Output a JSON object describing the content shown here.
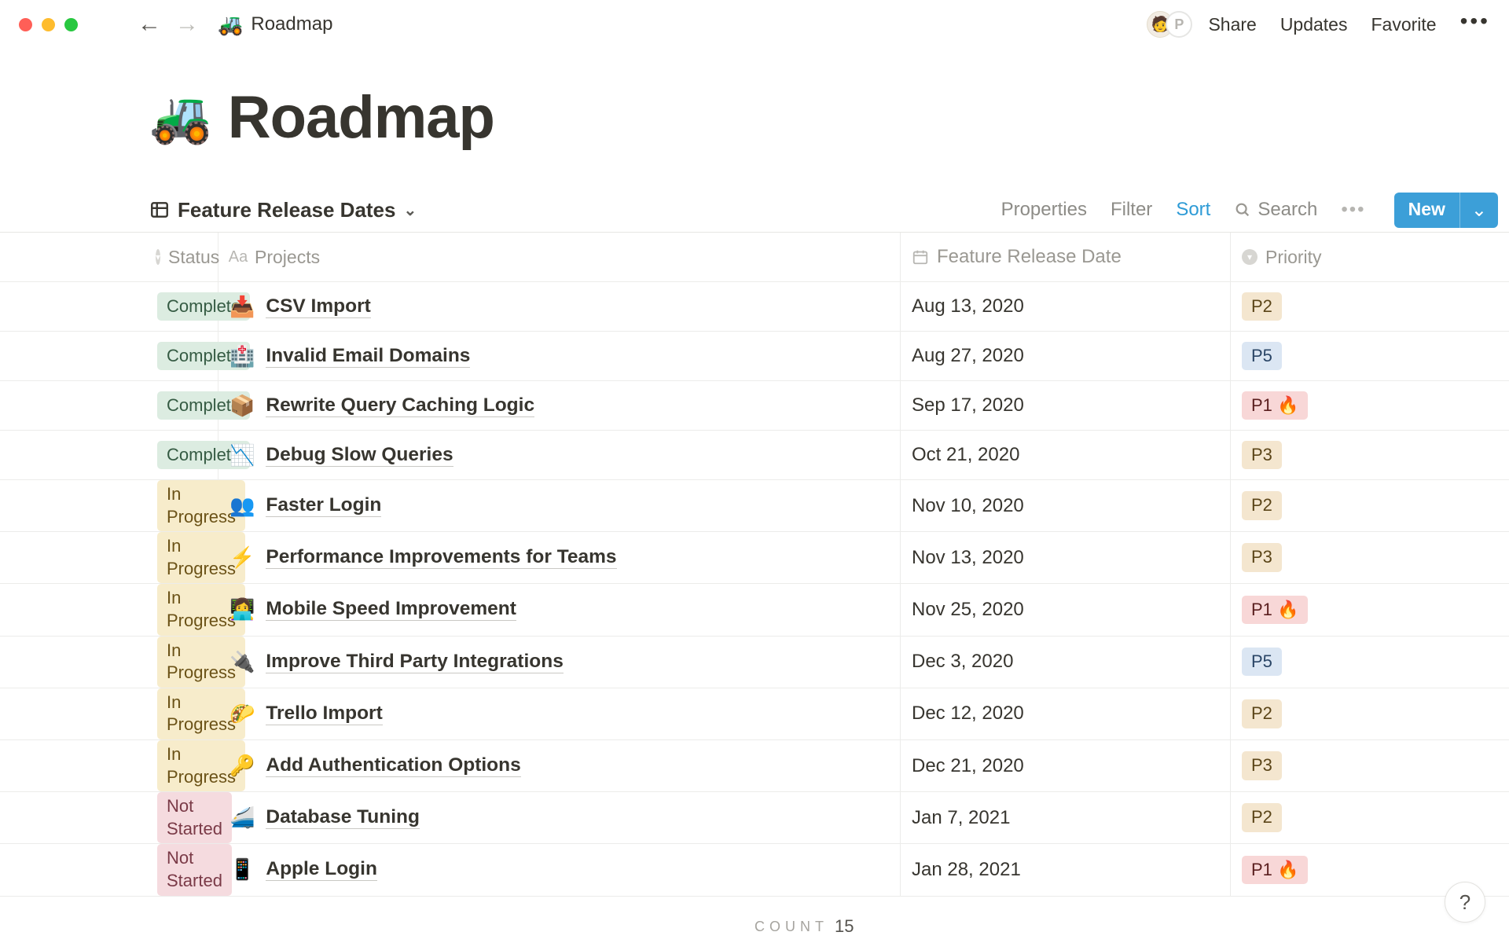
{
  "window": {
    "breadcrumb_icon": "🚜",
    "breadcrumb_title": "Roadmap"
  },
  "toolbar": {
    "share": "Share",
    "updates": "Updates",
    "favorite": "Favorite",
    "presence_initial": "P"
  },
  "page": {
    "icon": "🚜",
    "title": "Roadmap"
  },
  "viewbar": {
    "view_name": "Feature Release Dates",
    "properties": "Properties",
    "filter": "Filter",
    "sort": "Sort",
    "search": "Search",
    "new": "New"
  },
  "columns": {
    "status": "Status",
    "projects": "Projects",
    "date": "Feature Release Date",
    "priority": "Priority"
  },
  "status_styles": {
    "Complete": "st-complete",
    "In Progress": "st-progress",
    "Not Started": "st-notstarted"
  },
  "priority_styles": {
    "P1 🔥": "pr-p1",
    "P2": "pr-p2",
    "P3": "pr-p3",
    "P5": "pr-p5"
  },
  "rows": [
    {
      "status": "Complete",
      "emoji": "📥",
      "project": "CSV Import",
      "date": "Aug 13, 2020",
      "priority": "P2"
    },
    {
      "status": "Complete",
      "emoji": "🏥",
      "project": "Invalid Email Domains",
      "date": "Aug 27, 2020",
      "priority": "P5"
    },
    {
      "status": "Complete",
      "emoji": "📦",
      "project": "Rewrite Query Caching Logic",
      "date": "Sep 17, 2020",
      "priority": "P1 🔥"
    },
    {
      "status": "Complete",
      "emoji": "📉",
      "project": "Debug Slow Queries",
      "date": "Oct 21, 2020",
      "priority": "P3"
    },
    {
      "status": "In Progress",
      "emoji": "👥",
      "project": "Faster Login",
      "date": "Nov 10, 2020",
      "priority": "P2"
    },
    {
      "status": "In Progress",
      "emoji": "⚡",
      "project": "Performance Improvements for Teams",
      "date": "Nov 13, 2020",
      "priority": "P3"
    },
    {
      "status": "In Progress",
      "emoji": "👩‍💻",
      "project": "Mobile Speed Improvement",
      "date": "Nov 25, 2020",
      "priority": "P1 🔥"
    },
    {
      "status": "In Progress",
      "emoji": "🔌",
      "project": "Improve Third Party Integrations",
      "date": "Dec 3, 2020",
      "priority": "P5"
    },
    {
      "status": "In Progress",
      "emoji": "🌮",
      "project": "Trello Import",
      "date": "Dec 12, 2020",
      "priority": "P2"
    },
    {
      "status": "In Progress",
      "emoji": "🔑",
      "project": "Add Authentication Options",
      "date": "Dec 21, 2020",
      "priority": "P3"
    },
    {
      "status": "Not Started",
      "emoji": "🚄",
      "project": "Database Tuning",
      "date": "Jan 7, 2021",
      "priority": "P2"
    },
    {
      "status": "Not Started",
      "emoji": "📱",
      "project": "Apple Login",
      "date": "Jan 28, 2021",
      "priority": "P1 🔥"
    }
  ],
  "footer": {
    "count_label": "COUNT",
    "count_value": "15"
  },
  "help": "?"
}
